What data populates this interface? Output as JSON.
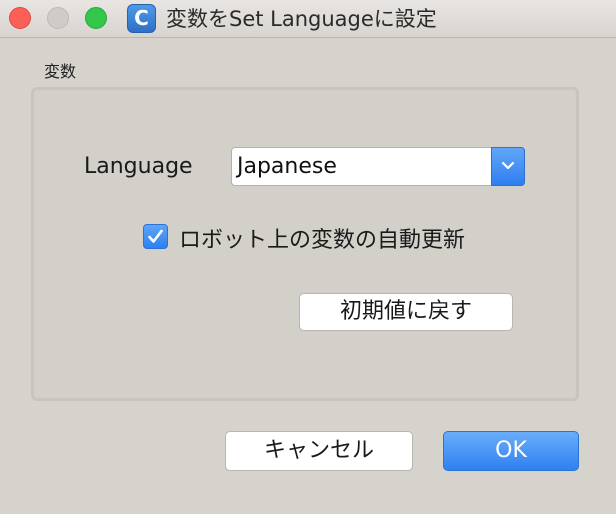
{
  "window": {
    "title": "変数をSet Languageに設定",
    "app_icon_letter": "C",
    "app_icon_color": "#3b82d8"
  },
  "group": {
    "title": "変数"
  },
  "language": {
    "label": "Language",
    "selected": "Japanese"
  },
  "auto_update": {
    "label": "ロボット上の変数の自動更新",
    "checked": true
  },
  "buttons": {
    "reset": "初期値に戻す",
    "cancel": "キャンセル",
    "ok": "OK"
  },
  "colors": {
    "accent": "#2f80f1",
    "close": "#fc5f57",
    "maximize": "#34c84a"
  },
  "icons": {
    "close": "close-icon",
    "minimize": "minimize-icon",
    "maximize": "maximize-icon",
    "dropdown": "chevron-down-icon",
    "check": "checkmark-icon"
  }
}
